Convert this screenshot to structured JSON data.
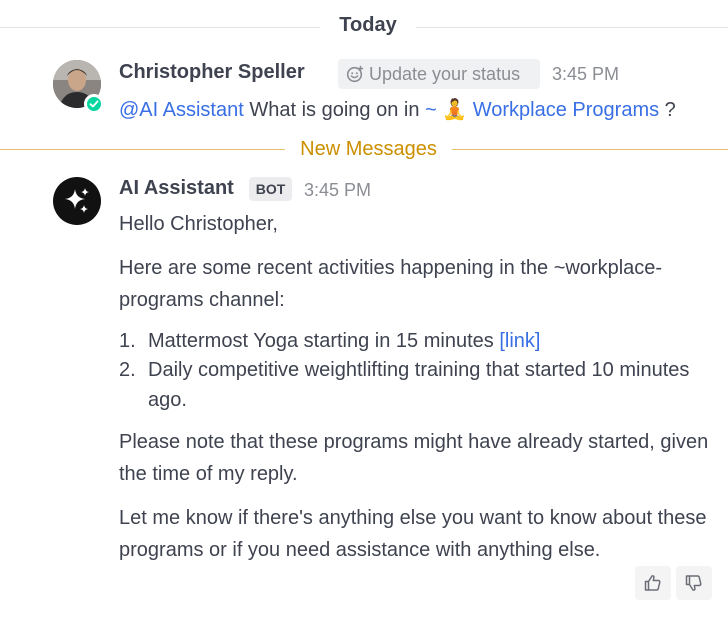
{
  "date_separator": "Today",
  "new_messages_separator": "New Messages",
  "user_post": {
    "author": "Christopher Speller",
    "status_placeholder": "Update your status",
    "time": "3:45 PM",
    "mention": "@AI Assistant",
    "text_before": "What is going on in",
    "channel_prefix": "~",
    "channel_emoji": "🧘",
    "channel_name": "Workplace Programs",
    "text_after": "?"
  },
  "bot_post": {
    "author": "AI Assistant",
    "badge": "BOT",
    "time": "3:45 PM",
    "greeting": "Hello Christopher,",
    "intro": "Here are some recent activities happening in the ~workplace-programs channel:",
    "items": [
      {
        "number": "1.",
        "text": "Mattermost Yoga starting in 15 minutes",
        "link": "[link]"
      },
      {
        "number": "2.",
        "text": "Daily competitive weightlifting training that started 10 minutes ago.",
        "link": ""
      }
    ],
    "note": "Please note that these programs might have already started, given the time of my reply.",
    "closing": "Let me know if there's anything else you want to know about these programs or if you need assistance with anything else."
  },
  "icons": {
    "status_dot": "check-icon",
    "status_chip": "smiley-icon",
    "bot_avatar": "sparkle-icon",
    "thumbs_up": "thumbs-up-icon",
    "thumbs_down": "thumbs-down-icon"
  },
  "colors": {
    "link": "#386fe5",
    "new_messages": "#cc8f00",
    "online": "#06d6a0",
    "text": "#3f4350",
    "muted": "#8b8d94"
  }
}
